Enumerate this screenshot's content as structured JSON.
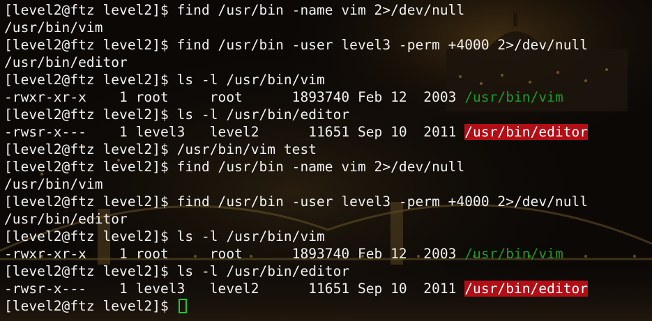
{
  "terminal": {
    "cursor_color": "#21c732",
    "highlight_color": "#b30d16",
    "green_link_color": "#1f9a2a",
    "lines": [
      {
        "type": "plain",
        "text": "[level2@ftz level2]$ find /usr/bin -name vim 2>/dev/null"
      },
      {
        "type": "plain",
        "text": "/usr/bin/vim"
      },
      {
        "type": "plain",
        "text": "[level2@ftz level2]$ find /usr/bin -user level3 -perm +4000 2>/dev/null"
      },
      {
        "type": "plain",
        "text": "/usr/bin/editor"
      },
      {
        "type": "plain",
        "text": "[level2@ftz level2]$ ls -l /usr/bin/vim"
      },
      {
        "type": "entry",
        "prefix": "-rwxr-xr-x    1 root     root      1893740 Feb 12  2003 ",
        "path": "/usr/bin/vim",
        "style": "green"
      },
      {
        "type": "plain",
        "text": "[level2@ftz level2]$ ls -l /usr/bin/editor"
      },
      {
        "type": "entry",
        "prefix": "-rwsr-x---    1 level3   level2      11651 Sep 10  2011 ",
        "path": "/usr/bin/editor",
        "style": "highlight"
      },
      {
        "type": "plain",
        "text": "[level2@ftz level2]$ /usr/bin/vim test"
      },
      {
        "type": "plain",
        "text": "[level2@ftz level2]$ find /usr/bin -name vim 2>/dev/null"
      },
      {
        "type": "plain",
        "text": "/usr/bin/vim"
      },
      {
        "type": "plain",
        "text": "[level2@ftz level2]$ find /usr/bin -user level3 -perm +4000 2>/dev/null"
      },
      {
        "type": "plain",
        "text": "/usr/bin/editor"
      },
      {
        "type": "plain",
        "text": "[level2@ftz level2]$ ls -l /usr/bin/vim"
      },
      {
        "type": "entry",
        "prefix": "-rwxr-xr-x    1 root     root      1893740 Feb 12  2003 ",
        "path": "/usr/bin/vim",
        "style": "green"
      },
      {
        "type": "plain",
        "text": "[level2@ftz level2]$ ls -l /usr/bin/editor"
      },
      {
        "type": "entry",
        "prefix": "-rwsr-x---    1 level3   level2      11651 Sep 10  2011 ",
        "path": "/usr/bin/editor",
        "style": "highlight"
      }
    ],
    "prompt": "[level2@ftz level2]$ "
  }
}
